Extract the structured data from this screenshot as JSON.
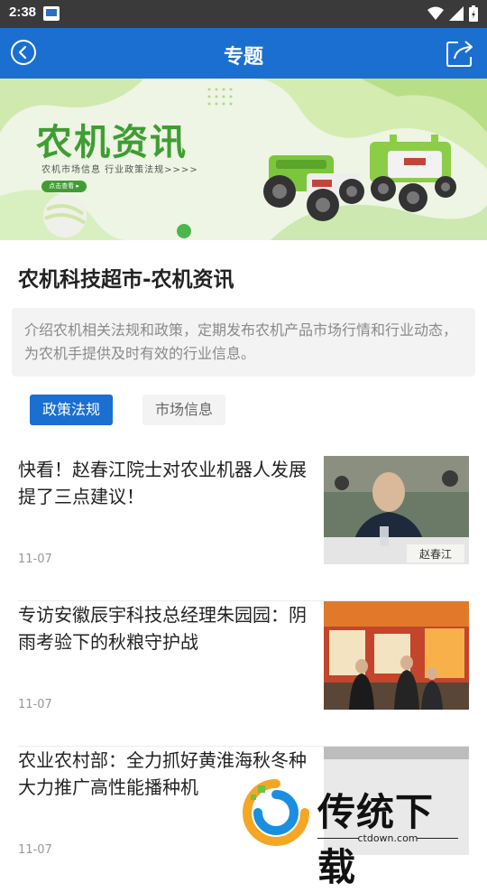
{
  "status_bar": {
    "time": "2:38"
  },
  "app_bar": {
    "title": "专题"
  },
  "banner": {
    "title": "农机资讯",
    "subtitle": "农机市场信息  行业政策法规>>>>",
    "button_label": "点击查看 ▸"
  },
  "topic": {
    "headline": "农机科技超市-农机资讯",
    "description": "介绍农机相关法规和政策，定期发布农机产品市场行情和行业动态，为农机手提供及时有效的行业信息。"
  },
  "tabs": [
    {
      "label": "政策法规",
      "active": true
    },
    {
      "label": "市场信息",
      "active": false
    }
  ],
  "articles": [
    {
      "title": "快看！赵春江院士对农业机器人发展提了三点建议！",
      "date": "11-07",
      "image_caption": "赵春江"
    },
    {
      "title": "专访安徽辰宇科技总经理朱园园：阴雨考验下的秋粮守护战",
      "date": "11-07"
    },
    {
      "title": "农业农村部：全力抓好黄淮海秋冬种 大力推广高性能播种机",
      "date": "11-07"
    }
  ],
  "watermark": {
    "text": "传统下载",
    "url": "ctdown.com"
  },
  "colors": {
    "primary": "#1a6fd1",
    "banner_green": "#3f9d33",
    "statusbar": "#3a3a3a"
  }
}
